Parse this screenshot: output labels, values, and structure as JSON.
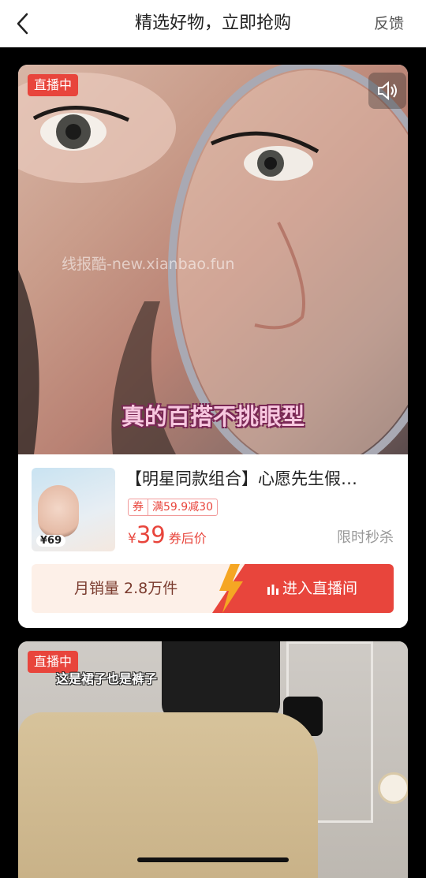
{
  "header": {
    "title": "精选好物，立即抢购",
    "feedback": "反馈"
  },
  "live_card": {
    "badge": "直播中",
    "watermark": "线报酷-new.xianbao.fun",
    "video_subtitle": "真的百搭不挑眼型",
    "product": {
      "title": "【明星同款组合】心愿先生假…",
      "thumb_price": "¥69",
      "coupon_tag": "券",
      "coupon_text": "满59.9减30",
      "price_symbol": "¥",
      "price": "39",
      "price_suffix": "券后价",
      "flash_sale": "限时秒杀",
      "monthly_sales": "月销量 2.8万件",
      "enter_live": "进入直播间"
    }
  },
  "second_card": {
    "badge": "直播中",
    "video_caption": "这是裙子也是裤子"
  },
  "icons": {
    "back": "chevron-left-icon",
    "sound": "speaker-icon",
    "live": "live-bars-icon"
  },
  "colors": {
    "accent": "#e8453c",
    "bar_bg": "#fdf0e8",
    "bolt": "#f5a623"
  }
}
